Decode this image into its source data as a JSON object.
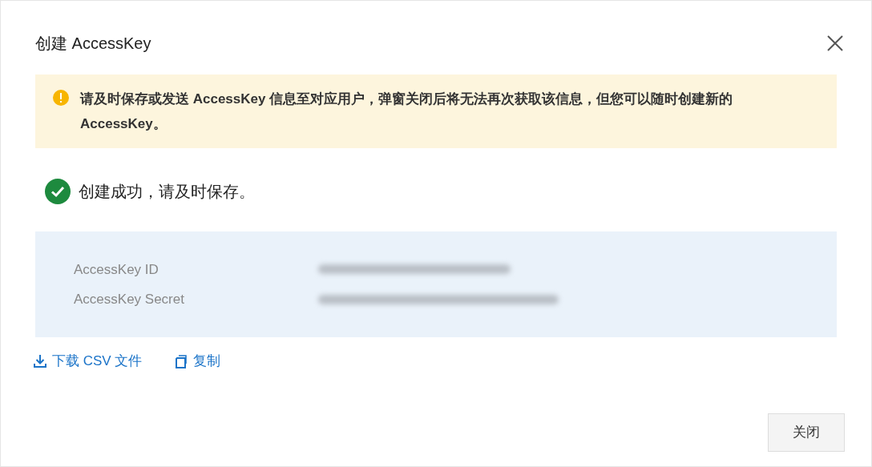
{
  "dialog": {
    "title": "创建 AccessKey"
  },
  "warning": {
    "text": "请及时保存或发送 AccessKey 信息至对应用户，弹窗关闭后将无法再次获取该信息，但您可以随时创建新的 AccessKey。"
  },
  "success": {
    "text": "创建成功，请及时保存。"
  },
  "credentials": [
    {
      "label": "AccessKey ID",
      "redacted": true
    },
    {
      "label": "AccessKey Secret",
      "redacted": true
    }
  ],
  "actions": [
    {
      "kind": "download",
      "label": "下载 CSV 文件"
    },
    {
      "kind": "copy",
      "label": "复制"
    }
  ],
  "buttons": [
    {
      "label": "关闭"
    }
  ]
}
